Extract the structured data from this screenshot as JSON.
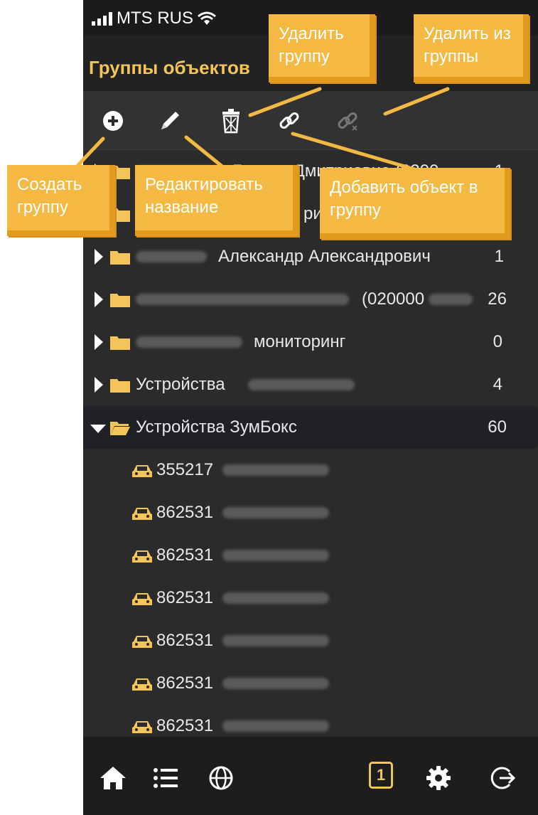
{
  "status": {
    "carrier": "MTS RUS"
  },
  "header": {
    "title": "Группы объектов"
  },
  "toolbar": {
    "icons": [
      "add-icon",
      "pencil-icon",
      "trash-icon",
      "link-icon",
      "unlink-icon"
    ]
  },
  "tree": {
    "groups": [
      {
        "name_visible": "Галина Дмитриевна (0200",
        "count": "1",
        "expanded": false
      },
      {
        "name_visible": "ри",
        "count": "",
        "expanded": false
      },
      {
        "name_visible": "Александр Александрович",
        "count": "1",
        "expanded": false
      },
      {
        "name_visible": "(020000",
        "count": "26",
        "expanded": false
      },
      {
        "name_visible": "мониторинг",
        "count": "0",
        "expanded": false
      },
      {
        "name_visible": "Устройства",
        "count": "4",
        "expanded": false
      },
      {
        "name_visible": "Устройства ЗумБокс",
        "count": "60",
        "expanded": true
      }
    ],
    "objects": [
      "355217",
      "862531",
      "862531",
      "862531",
      "862531",
      "862531",
      "862531"
    ]
  },
  "navbar": {
    "icons": [
      "home-icon",
      "list-icon",
      "globe-icon",
      "gear-icon",
      "logout-icon"
    ],
    "badge": "1"
  },
  "callouts": {
    "delete_group": "Удалить группу",
    "remove_from_group": "Удалить из группы",
    "create_group": "Создать группу",
    "edit_name": "Редактировать название",
    "add_object": "Добавить объект в группу"
  },
  "colors": {
    "accent": "#f2c45a",
    "callout": "#f4b942",
    "background": "#2b2b2b"
  }
}
